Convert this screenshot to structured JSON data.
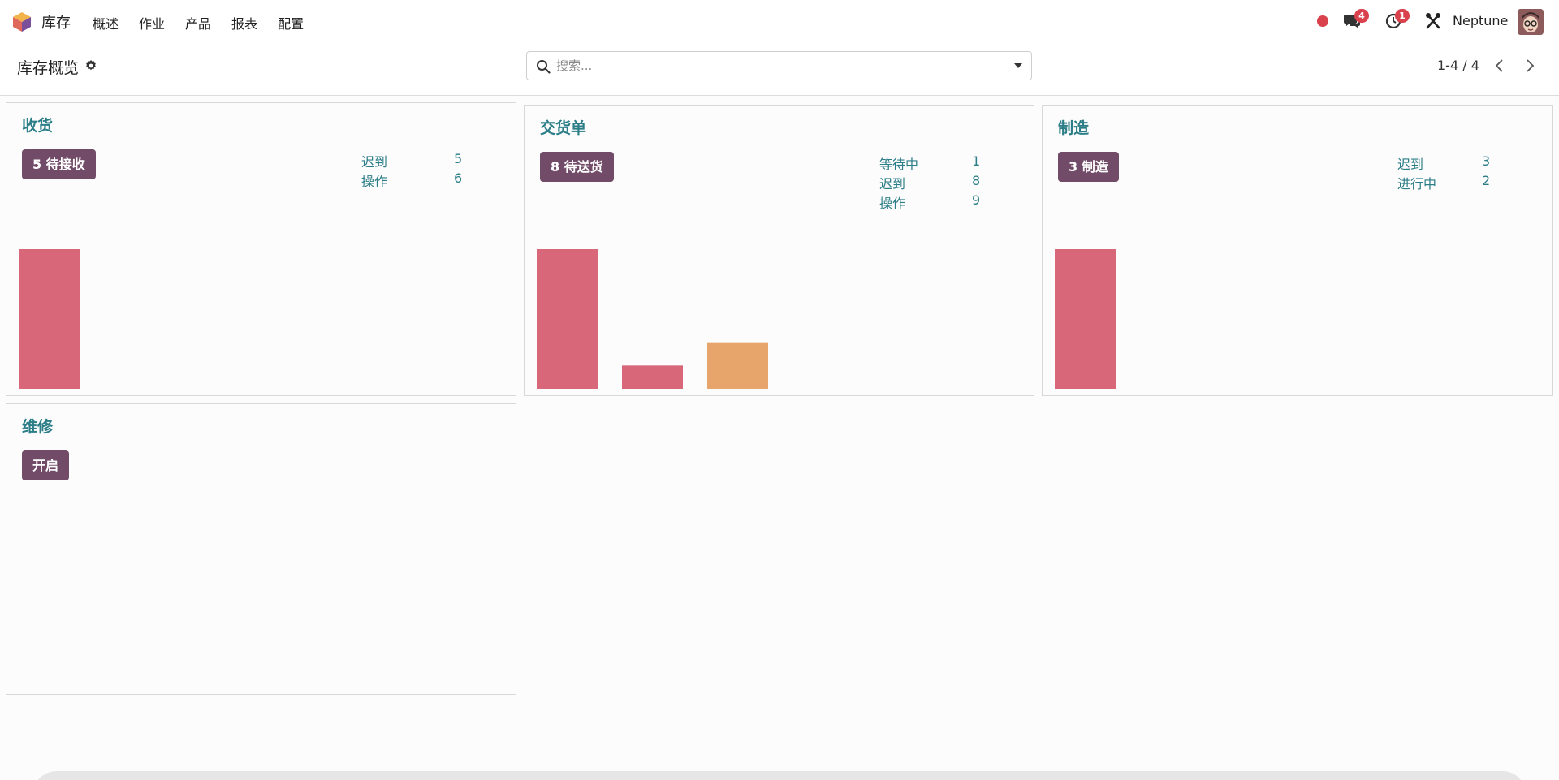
{
  "app": {
    "name": "库存"
  },
  "menu": [
    "概述",
    "作业",
    "产品",
    "报表",
    "配置"
  ],
  "systray": {
    "chat_count": "4",
    "activity_count": "1",
    "user_name": "Neptune"
  },
  "control": {
    "breadcrumb": "库存概览",
    "search_placeholder": "搜索...",
    "pager": "1-4 / 4"
  },
  "colors": {
    "primary": "#714b67",
    "accent": "#2b7d87",
    "late_bar": "#d9677a",
    "future_bar": "#e8a56b"
  },
  "cards": [
    {
      "title": "收货",
      "button": "5 待接收",
      "stats": [
        {
          "label": "迟到",
          "value": "5"
        },
        {
          "label": "操作",
          "value": "6"
        }
      ],
      "chart_data": {
        "type": "bar",
        "values": [
          5
        ],
        "colors": [
          "late"
        ]
      }
    },
    {
      "title": "交货单",
      "button": "8 待送货",
      "stats": [
        {
          "label": "等待中",
          "value": "1"
        },
        {
          "label": "迟到",
          "value": "8"
        },
        {
          "label": "操作",
          "value": "9"
        }
      ],
      "chart_data": {
        "type": "bar",
        "values": [
          6,
          1,
          2
        ],
        "colors": [
          "late",
          "late",
          "future"
        ]
      }
    },
    {
      "title": "制造",
      "button": "3 制造",
      "stats": [
        {
          "label": "迟到",
          "value": "3"
        },
        {
          "label": "进行中",
          "value": "2"
        }
      ],
      "chart_data": {
        "type": "bar",
        "values": [
          3
        ],
        "colors": [
          "late"
        ]
      }
    },
    {
      "title": "维修",
      "button": "开启",
      "stats": [],
      "chart_data": null
    }
  ]
}
